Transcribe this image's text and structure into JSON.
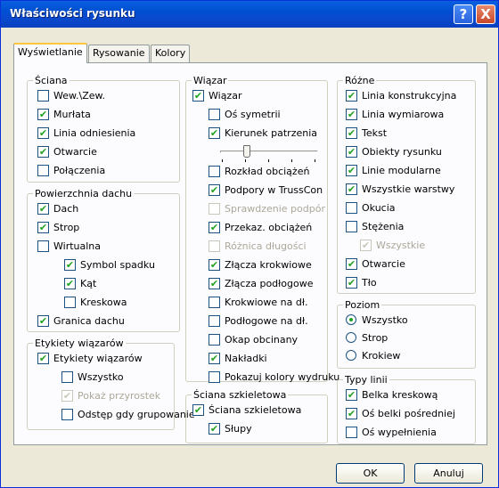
{
  "window": {
    "title": "Właściwości rysunku",
    "help_label": "?",
    "close_label": "X"
  },
  "tabs": [
    "Wyświetlanie",
    "Rysowanie",
    "Kolory"
  ],
  "groups": {
    "sciana": {
      "title": "Ściana",
      "items": [
        {
          "label": "Wew.\\Zew.",
          "checked": false
        },
        {
          "label": "Murłata",
          "checked": true
        },
        {
          "label": "Linia odniesienia",
          "checked": true
        },
        {
          "label": "Otwarcie",
          "checked": true
        },
        {
          "label": "Połączenia",
          "checked": false
        }
      ]
    },
    "powierzchnia": {
      "title": "Powierzchnia dachu",
      "items": [
        {
          "label": "Dach",
          "checked": true
        },
        {
          "label": "Strop",
          "checked": true
        },
        {
          "label": "Wirtualna",
          "checked": false
        },
        {
          "label": "Symbol spadku",
          "checked": true
        },
        {
          "label": "Kąt",
          "checked": true
        },
        {
          "label": "Kreskowa",
          "checked": false
        },
        {
          "label": "Granica dachu",
          "checked": true
        }
      ]
    },
    "etykiety": {
      "title": "Etykiety wiązarów",
      "items": [
        {
          "label": "Etykiety wiązarów",
          "checked": true
        },
        {
          "label": "Wszystko",
          "checked": false
        },
        {
          "label": "Pokaż przyrostek",
          "checked": true,
          "disabled": true
        },
        {
          "label": "Odstęp gdy grupowanie",
          "checked": false
        }
      ]
    },
    "wiazar": {
      "title": "Wiązar",
      "items": [
        {
          "label": "Wiązar",
          "checked": true
        },
        {
          "label": "Oś symetrii",
          "checked": false
        },
        {
          "label": "Kierunek patrzenia",
          "checked": true
        },
        {
          "label": "Rozkład obciążeń",
          "checked": false
        },
        {
          "label": "Podpory w TrussCon",
          "checked": true
        },
        {
          "label": "Sprawdzenie podpór",
          "checked": false,
          "disabled": true
        },
        {
          "label": "Przekaz. obciążeń",
          "checked": true
        },
        {
          "label": "Różnica długości",
          "checked": false,
          "disabled": true
        },
        {
          "label": "Złącza krokwiowe",
          "checked": true
        },
        {
          "label": "Złącza podłogowe",
          "checked": true
        },
        {
          "label": "Krokwiowe na dł.",
          "checked": false
        },
        {
          "label": "Podłogowe na dł.",
          "checked": false
        },
        {
          "label": "Okap obcinany",
          "checked": false
        },
        {
          "label": "Nakładki",
          "checked": true
        },
        {
          "label": "Pokazuj kolory wydruku",
          "checked": false
        }
      ],
      "slider_value": 0.25
    },
    "sciana_szkieletowa": {
      "title": "Ściana szkieletowa",
      "items": [
        {
          "label": "Ściana szkieletowa",
          "checked": true
        },
        {
          "label": "Słupy",
          "checked": true
        }
      ]
    },
    "rozne": {
      "title": "Różne",
      "items": [
        {
          "label": "Linia konstrukcyjna",
          "checked": true
        },
        {
          "label": "Linia wymiarowa",
          "checked": true
        },
        {
          "label": "Tekst",
          "checked": true
        },
        {
          "label": "Obiekty rysunku",
          "checked": true
        },
        {
          "label": "Linie modularne",
          "checked": true
        },
        {
          "label": "Wszystkie warstwy",
          "checked": true
        },
        {
          "label": "Okucia",
          "checked": false
        },
        {
          "label": "Stężenia",
          "checked": false
        },
        {
          "label": "Wszystkie",
          "checked": true,
          "disabled": true
        },
        {
          "label": "Otwarcie",
          "checked": true
        },
        {
          "label": "Tło",
          "checked": true
        }
      ]
    },
    "poziom": {
      "title": "Poziom",
      "options": [
        "Wszystko",
        "Strop",
        "Krokiew"
      ],
      "selected": "Wszystko"
    },
    "typy": {
      "title": "Typy linii",
      "items": [
        {
          "label": "Belka kreskową",
          "checked": true
        },
        {
          "label": "Oś belki pośredniej",
          "checked": true
        },
        {
          "label": "Oś wypełnienia",
          "checked": false
        }
      ]
    }
  },
  "buttons": {
    "ok": "OK",
    "cancel": "Anuluj"
  },
  "colors": {
    "check": "#21a121",
    "titlebar": "#0a5fe0",
    "tab_highlight": "#ffc83c"
  }
}
